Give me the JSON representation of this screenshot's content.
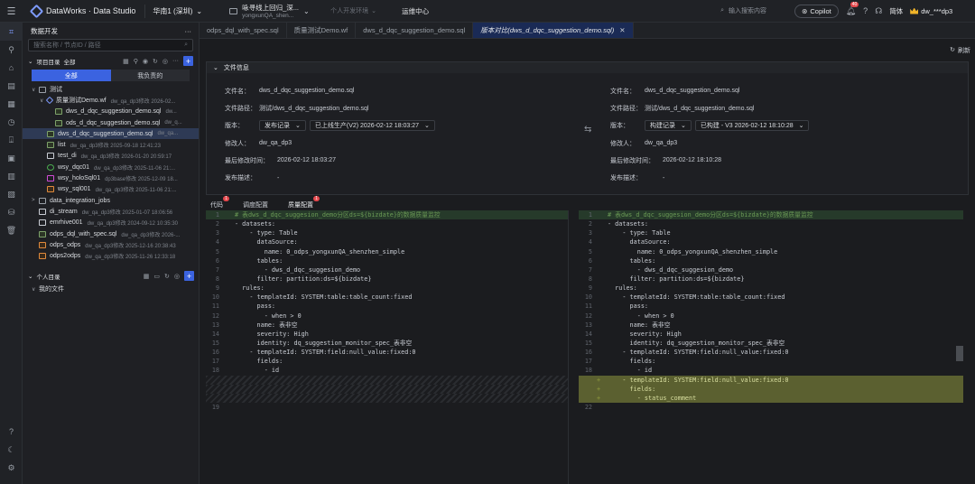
{
  "topbar": {
    "brand": "DataWorks · Data Studio",
    "region": "华南1 (深圳)",
    "workspace_line1": "咏寻线上回归_深...",
    "workspace_line2": "yongxunQA_shen...",
    "env": "个人开发环境",
    "ops": "运维中心",
    "search_placeholder": "输入搜索内容",
    "copilot": "Copilot",
    "notif_count": "40",
    "lang": "简体",
    "user": "dw_***dp3"
  },
  "sidebar": {
    "title": "数据开发",
    "search_placeholder": "搜索名称 / 节点ID / 路径",
    "project_dir": "项目目录",
    "scope": "全部",
    "seg_all": "全部",
    "seg_mine": "我负责的",
    "tree": [
      {
        "indent": 0,
        "arrow": "∨",
        "icon": "folder",
        "name": "测试",
        "meta": ""
      },
      {
        "indent": 1,
        "arrow": "∨",
        "icon": "wf",
        "name": "质量测试Demo.wf",
        "meta": "dw_qa_dp3修改 2026-02..."
      },
      {
        "indent": 2,
        "arrow": "",
        "icon": "sql",
        "name": "dws_d_dqc_suggestion_demo.sql",
        "meta": "dw..."
      },
      {
        "indent": 2,
        "arrow": "",
        "icon": "sql",
        "name": "ods_d_dqc_suggestion_demo.sql",
        "meta": "dw_q..."
      },
      {
        "indent": 1,
        "arrow": "",
        "icon": "sql",
        "name": "dws_d_dqc_suggestion_demo.sql",
        "meta": "dw_qa...",
        "selected": true
      },
      {
        "indent": 1,
        "arrow": "",
        "icon": "sql",
        "name": "list",
        "meta": "dw_qa_dp3修改 2025-09-18 12:41:23"
      },
      {
        "indent": 1,
        "arrow": "",
        "icon": "shell",
        "name": "test_di",
        "meta": "dw_qa_dp3修改 2026-01-20 20:59:17"
      },
      {
        "indent": 1,
        "arrow": "",
        "icon": "heart",
        "name": "wsy_dqc01",
        "meta": "dw_qa_dp3修改 2025-11-06 21:..."
      },
      {
        "indent": 1,
        "arrow": "",
        "icon": "holo",
        "name": "wsy_holoSql01",
        "meta": "dp3base修改 2025-12-09 18..."
      },
      {
        "indent": 1,
        "arrow": "",
        "icon": "odps",
        "name": "wsy_sql001",
        "meta": "dw_qa_dp3修改 2025-11-06 21:..."
      },
      {
        "indent": 0,
        "arrow": ">",
        "icon": "folder",
        "name": "data_integration_jobs",
        "meta": ""
      },
      {
        "indent": 0,
        "arrow": "",
        "icon": "shell",
        "name": "di_stream",
        "meta": "dw_qa_dp3修改 2025-01-07 18:06:56"
      },
      {
        "indent": 0,
        "arrow": "",
        "icon": "shell",
        "name": "emrhive001",
        "meta": "dw_qa_dp3修改 2024-09-12 10:35:30"
      },
      {
        "indent": 0,
        "arrow": "",
        "icon": "sql",
        "name": "odps_dql_with_spec.sql",
        "meta": "dw_qa_dp3修改 2026-..."
      },
      {
        "indent": 0,
        "arrow": "",
        "icon": "odps",
        "name": "odps_odps",
        "meta": "dw_qa_dp3修改 2025-12-16 20:38:43"
      },
      {
        "indent": 0,
        "arrow": "",
        "icon": "odps",
        "name": "odps2odps",
        "meta": "dw_qa_dp3修改 2025-11-26 12:33:18"
      }
    ],
    "personal_dir": "个人目录",
    "my_files": "我的文件"
  },
  "tabs": [
    {
      "label": "odps_dql_with_spec.sql",
      "active": false
    },
    {
      "label": "质量测试Demo.wf",
      "active": false
    },
    {
      "label": "dws_d_dqc_suggestion_demo.sql",
      "active": false
    },
    {
      "label": "版本对比(dws_d_dqc_suggestion_demo.sql)",
      "active": true
    }
  ],
  "main": {
    "refresh": "刷新",
    "info_title": "文件信息",
    "left": {
      "file_name_k": "文件名：",
      "file_name": "dws_d_dqc_suggestion_demo.sql",
      "path_k": "文件路径：",
      "path": "测试/dws_d_dqc_suggestion_demo.sql",
      "version_k": "版本：",
      "version_type": "发布记录",
      "version_val": "已上线生产(V2) 2026-02-12 18:03:27",
      "modifier_k": "修改人：",
      "modifier": "dw_qa_dp3",
      "mtime_k": "最后修改时间：",
      "mtime": "2026-02-12 18:03:27",
      "desc_k": "发布描述：",
      "desc": "-"
    },
    "right": {
      "file_name_k": "文件名：",
      "file_name": "dws_d_dqc_suggestion_demo.sql",
      "path_k": "文件路径：",
      "path": "测试/dws_d_dqc_suggestion_demo.sql",
      "version_k": "版本：",
      "version_type": "构建记录",
      "version_val": "已构建 - V3 2026-02-12 18:10:28",
      "modifier_k": "修改人：",
      "modifier": "dw_qa_dp3",
      "mtime_k": "最后修改时间：",
      "mtime": "2026-02-12 18:10:28",
      "desc_k": "发布描述：",
      "desc": "-"
    },
    "subtabs": [
      {
        "label": "代码",
        "badge": "1",
        "active": false
      },
      {
        "label": "调度配置",
        "badge": "",
        "active": false
      },
      {
        "label": "质量配置",
        "badge": "1",
        "active": true
      }
    ]
  },
  "left_code": [
    {
      "n": "1",
      "t": "# 表dws_d_dqc_suggesion_demo分区ds=${bizdate}的数据质量监控",
      "k": "first"
    },
    {
      "n": "2",
      "t": "- datasets:",
      "k": ""
    },
    {
      "n": "3",
      "t": "    - type: Table",
      "k": ""
    },
    {
      "n": "4",
      "t": "      dataSource:",
      "k": ""
    },
    {
      "n": "5",
      "t": "        name: 0_odps_yongxunQA_shenzhen_simple",
      "k": ""
    },
    {
      "n": "6",
      "t": "      tables:",
      "k": ""
    },
    {
      "n": "7",
      "t": "        - dws_d_dqc_suggesion_demo",
      "k": ""
    },
    {
      "n": "8",
      "t": "      filter: partition:ds=${bizdate}",
      "k": ""
    },
    {
      "n": "9",
      "t": "  rules:",
      "k": ""
    },
    {
      "n": "10",
      "t": "    - templateId: SYSTEM:table:table_count:fixed",
      "k": ""
    },
    {
      "n": "11",
      "t": "      pass:",
      "k": ""
    },
    {
      "n": "12",
      "t": "        - when > 0",
      "k": ""
    },
    {
      "n": "13",
      "t": "      name: 表非空",
      "k": ""
    },
    {
      "n": "14",
      "t": "      severity: High",
      "k": ""
    },
    {
      "n": "15",
      "t": "      identity: dq_suggestion_monitor_spec_表非空",
      "k": ""
    },
    {
      "n": "16",
      "t": "    - templateId: SYSTEM:field:null_value:fixed:0",
      "k": ""
    },
    {
      "n": "17",
      "t": "      fields:",
      "k": ""
    },
    {
      "n": "18",
      "t": "        - id",
      "k": ""
    },
    {
      "n": "",
      "t": "",
      "k": "hatch"
    },
    {
      "n": "",
      "t": "",
      "k": "hatch"
    },
    {
      "n": "",
      "t": "",
      "k": "hatch"
    },
    {
      "n": "19",
      "t": "",
      "k": ""
    }
  ],
  "right_code": [
    {
      "n": "1",
      "m": "",
      "t": "# 表dws_d_dqc_suggesion_demo分区ds=${bizdate}的数据质量监控",
      "k": "first"
    },
    {
      "n": "2",
      "m": "",
      "t": "- datasets:",
      "k": ""
    },
    {
      "n": "3",
      "m": "",
      "t": "    - type: Table",
      "k": ""
    },
    {
      "n": "4",
      "m": "",
      "t": "      dataSource:",
      "k": ""
    },
    {
      "n": "5",
      "m": "",
      "t": "        name: 0_odps_yongxunQA_shenzhen_simple",
      "k": ""
    },
    {
      "n": "6",
      "m": "",
      "t": "      tables:",
      "k": ""
    },
    {
      "n": "7",
      "m": "",
      "t": "        - dws_d_dqc_suggesion_demo",
      "k": ""
    },
    {
      "n": "8",
      "m": "",
      "t": "      filter: partition:ds=${bizdate}",
      "k": ""
    },
    {
      "n": "9",
      "m": "",
      "t": "  rules:",
      "k": ""
    },
    {
      "n": "10",
      "m": "",
      "t": "    - templateId: SYSTEM:table:table_count:fixed",
      "k": ""
    },
    {
      "n": "11",
      "m": "",
      "t": "      pass:",
      "k": ""
    },
    {
      "n": "12",
      "m": "",
      "t": "        - when > 0",
      "k": ""
    },
    {
      "n": "13",
      "m": "",
      "t": "      name: 表非空",
      "k": ""
    },
    {
      "n": "14",
      "m": "",
      "t": "      severity: High",
      "k": ""
    },
    {
      "n": "15",
      "m": "",
      "t": "      identity: dq_suggestion_monitor_spec_表非空",
      "k": ""
    },
    {
      "n": "16",
      "m": "",
      "t": "    - templateId: SYSTEM:field:null_value:fixed:0",
      "k": ""
    },
    {
      "n": "17",
      "m": "",
      "t": "      fields:",
      "k": ""
    },
    {
      "n": "18",
      "m": "",
      "t": "        - id",
      "k": ""
    },
    {
      "n": "",
      "m": "+",
      "t": "    - templateId: SYSTEM:field:null_value:fixed:0",
      "k": "added"
    },
    {
      "n": "",
      "m": "+",
      "t": "      fields:",
      "k": "added"
    },
    {
      "n": "",
      "m": "+",
      "t": "        - status_comment",
      "k": "added"
    },
    {
      "n": "22",
      "m": "",
      "t": "",
      "k": ""
    }
  ]
}
